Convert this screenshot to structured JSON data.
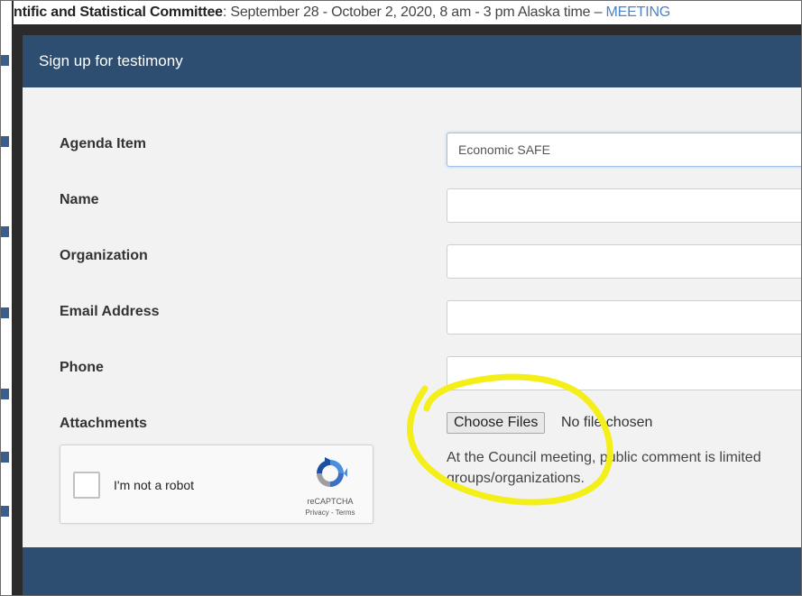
{
  "background": {
    "header_bold": "ntific and Statistical Committee",
    "header_rest": ": September 28 - October 2, 2020, 8 am - 3 pm Alaska time – ",
    "header_link": "MEETING"
  },
  "modal": {
    "title": "Sign up for testimony",
    "fields": {
      "agenda_item": {
        "label": "Agenda Item",
        "value": "Economic SAFE"
      },
      "name": {
        "label": "Name",
        "value": ""
      },
      "organization": {
        "label": "Organization",
        "value": ""
      },
      "email": {
        "label": "Email Address",
        "value": ""
      },
      "phone": {
        "label": "Phone",
        "value": ""
      }
    },
    "attachments": {
      "label": "Attachments",
      "button": "Choose Files",
      "status": "No file chosen",
      "help_line1": "At the Council meeting, public comment is limited",
      "help_line2": "groups/organizations."
    },
    "captcha": {
      "label": "I'm not a robot",
      "brand": "reCAPTCHA",
      "terms": "Privacy - Terms"
    }
  },
  "colors": {
    "header": "#2d4e70",
    "body": "#f2f2f2",
    "highlight": "#f4ee19"
  }
}
